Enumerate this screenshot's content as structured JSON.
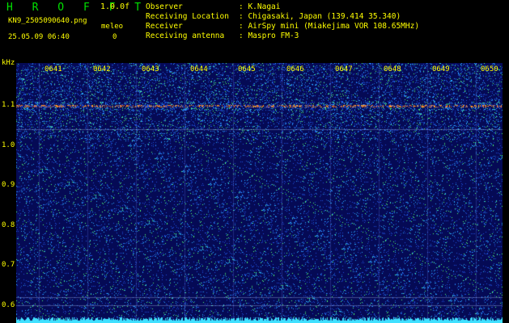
{
  "header": {
    "app_title": "H R O F F T",
    "version": "1.0.0f",
    "filename": "KN9_2505090640.png",
    "meleo_label": "meleo",
    "datetime": "25.05.09 06:40",
    "meleo_count": "0"
  },
  "info": [
    {
      "key": "Observer",
      "value": ": K.Nagai"
    },
    {
      "key": "Receiving Location",
      "value": ": Chigasaki, Japan (139.414 35.340)"
    },
    {
      "key": "Receiver",
      "value": ": AirSpy mini (Miakejima VOR 108.65MHz)"
    },
    {
      "key": "Receiving antenna",
      "value": ": Maspro FM-3"
    }
  ],
  "axis": {
    "unit": "kHz",
    "y_ticks": [
      "1.1",
      "1.0",
      "0.9",
      "0.8",
      "0.7",
      "0.6"
    ],
    "x_ticks": [
      "0641",
      "0642",
      "0643",
      "0644",
      "0645",
      "0646",
      "0647",
      "0648",
      "0649",
      "0650"
    ]
  },
  "colors": {
    "text": "#ffff00",
    "title": "#00e000",
    "background": "#050a55",
    "carrier": "#ff3030"
  }
}
